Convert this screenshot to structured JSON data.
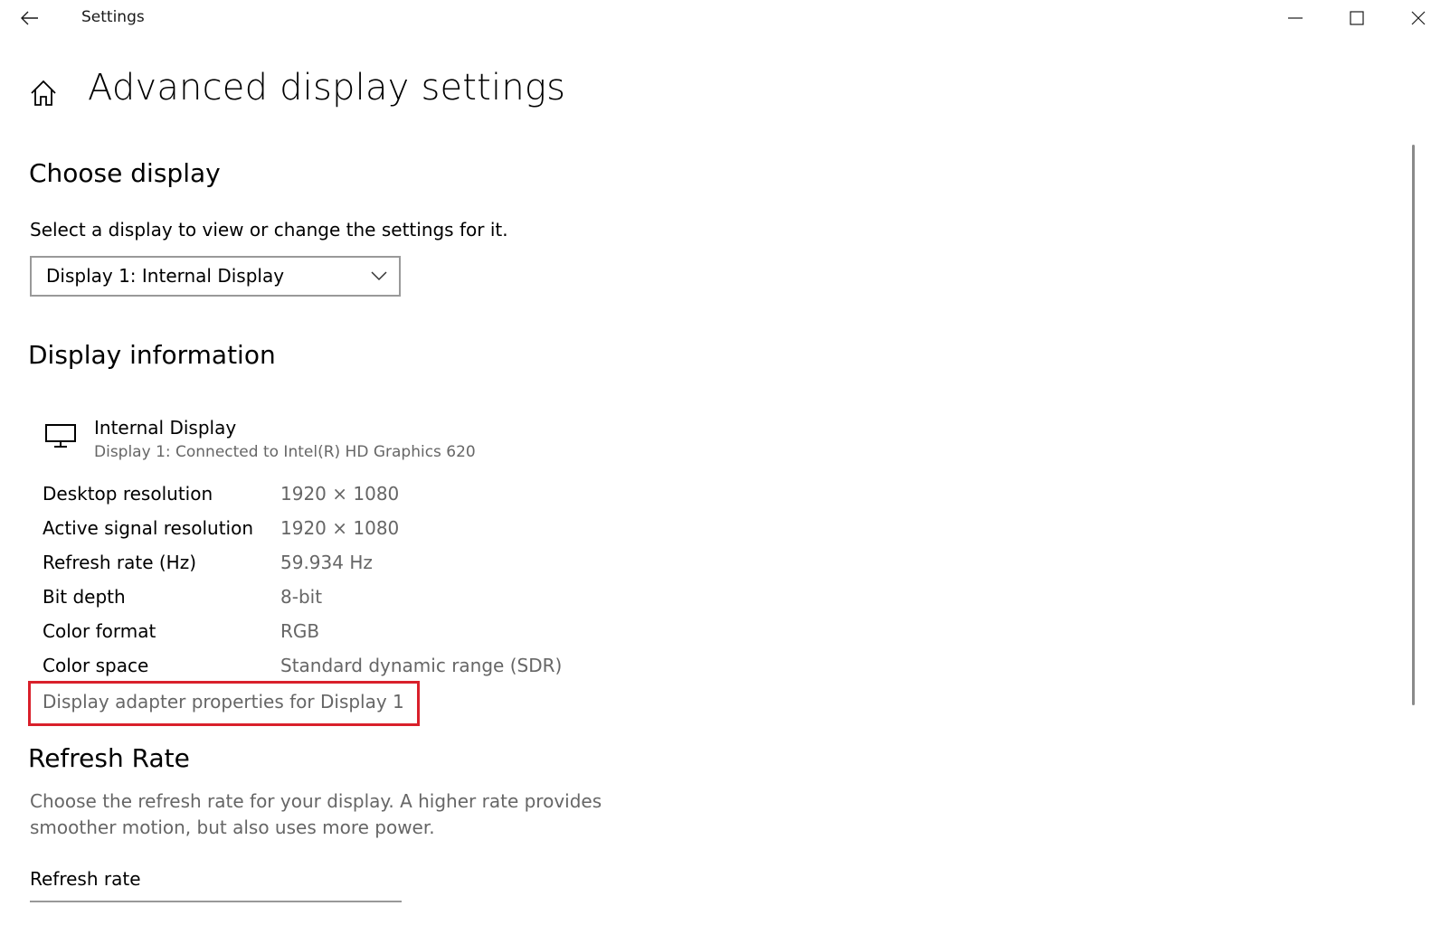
{
  "window": {
    "app_title": "Settings",
    "back_icon": "arrow-left-icon",
    "minimize_icon": "minimize-icon",
    "maximize_icon": "maximize-icon",
    "close_icon": "close-icon"
  },
  "header": {
    "home_icon": "home-icon",
    "title": "Advanced display settings"
  },
  "choose_display": {
    "heading": "Choose display",
    "instruction": "Select a display to view or change the settings for it.",
    "dropdown_value": "Display 1: Internal Display",
    "dropdown_icon": "chevron-down-icon"
  },
  "display_information": {
    "heading": "Display information",
    "monitor_icon": "monitor-icon",
    "display_name": "Internal Display",
    "display_subtitle": "Display 1: Connected to Intel(R) HD Graphics 620",
    "rows": [
      {
        "label": "Desktop resolution",
        "value": "1920 × 1080"
      },
      {
        "label": "Active signal resolution",
        "value": "1920 × 1080"
      },
      {
        "label": "Refresh rate (Hz)",
        "value": "59.934 Hz"
      },
      {
        "label": "Bit depth",
        "value": "8-bit"
      },
      {
        "label": "Color format",
        "value": "RGB"
      },
      {
        "label": "Color space",
        "value": "Standard dynamic range (SDR)"
      }
    ],
    "adapter_link": "Display adapter properties for Display 1",
    "highlight_color": "#d9202b"
  },
  "refresh_rate": {
    "heading": "Refresh Rate",
    "description": "Choose the refresh rate for your display. A higher rate provides smoother motion, but also uses more power.",
    "field_label": "Refresh rate"
  },
  "colors": {
    "text_primary": "#000000",
    "text_secondary": "#666666",
    "border": "#999999",
    "background": "#ffffff"
  }
}
